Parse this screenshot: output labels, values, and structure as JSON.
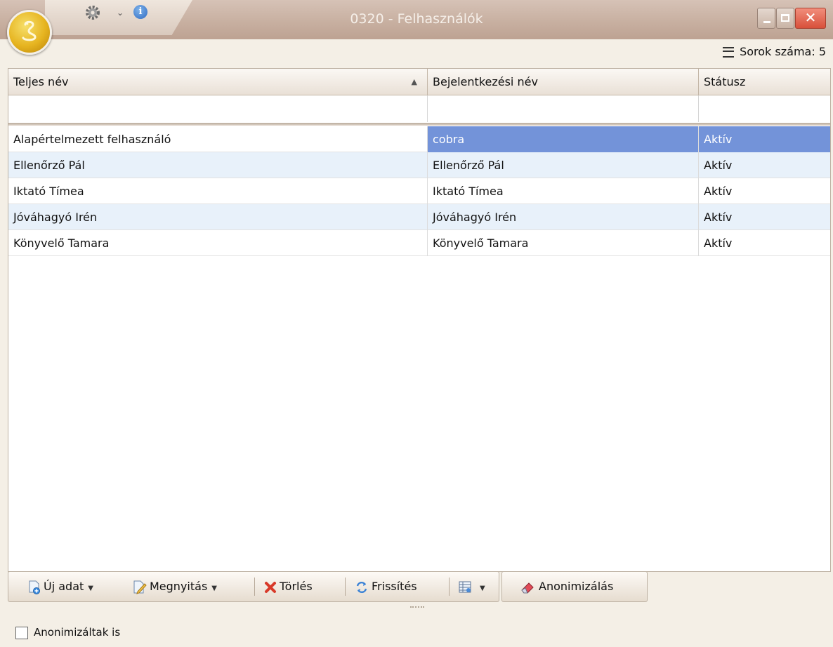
{
  "window": {
    "title": "0320 - Felhasználók"
  },
  "info_row": {
    "row_count_label": "Sorok száma: 5"
  },
  "grid": {
    "columns": [
      {
        "label": "Teljes név",
        "sort": "ascending"
      },
      {
        "label": "Bejelentkezési név"
      },
      {
        "label": "Státusz"
      }
    ],
    "rows": [
      {
        "full_name": "Alapértelmezett felhasználó",
        "login": "cobra",
        "status": "Aktív",
        "selected": true
      },
      {
        "full_name": "Ellenőrző Pál",
        "login": "Ellenőrző Pál",
        "status": "Aktív"
      },
      {
        "full_name": "Iktató Tímea",
        "login": "Iktató Tímea",
        "status": "Aktív"
      },
      {
        "full_name": "Jóváhagyó Irén",
        "login": "Jóváhagyó Irén",
        "status": "Aktív"
      },
      {
        "full_name": "Könyvelő Tamara",
        "login": "Könyvelő Tamara",
        "status": "Aktív"
      }
    ]
  },
  "toolbar": {
    "new_label": "Új adat",
    "open_label": "Megnyitás",
    "delete_label": "Törlés",
    "refresh_label": "Frissítés",
    "anonymize_label": "Anonimizálás"
  },
  "footer": {
    "checkbox_label": "Anonimizáltak is",
    "checkbox_checked": false
  },
  "icons": {
    "app": "cobra-logo-icon",
    "settings": "gear-icon",
    "info": "info-icon",
    "rows": "list-lines-icon",
    "new": "new-document-icon",
    "open": "edit-document-icon",
    "delete": "red-x-icon",
    "refresh": "refresh-icon",
    "layout": "grid-layout-icon",
    "anonymize": "eraser-icon"
  },
  "colors": {
    "selection": "#7393d9",
    "alt_row": "#e8f1fa",
    "close_button": "#d8503b",
    "title_bar": "#c8b0a1"
  }
}
